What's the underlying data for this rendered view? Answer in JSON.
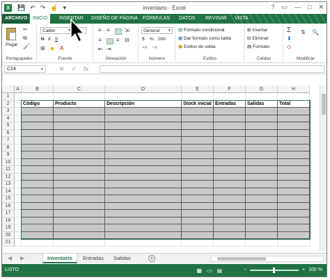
{
  "window": {
    "title": "inventario - Excel",
    "app_icon": "X",
    "qat": [
      "save-icon",
      "undo-icon",
      "redo-icon",
      "touch-mode-icon"
    ],
    "controls": [
      "?",
      "▭",
      "—",
      "□",
      "✕"
    ]
  },
  "tabs": {
    "file": "ARCHIVO",
    "items": [
      "INICIO",
      "INSERTAR",
      "DISEÑO DE PÁGINA",
      "FÓRMULAS",
      "DATOS",
      "REVISAR",
      "VISTA"
    ],
    "active": "INICIO"
  },
  "ribbon": {
    "clipboard": {
      "label": "Portapapeles",
      "paste": "Pegar"
    },
    "font": {
      "label": "Fuente",
      "font_name": "Calibri",
      "font_size": "11",
      "buttons": [
        "N",
        "K",
        "S"
      ]
    },
    "alignment": {
      "label": "Alineación"
    },
    "number": {
      "label": "Número",
      "format": "General",
      "buttons": [
        "$",
        "%",
        "000"
      ]
    },
    "styles": {
      "label": "Estilos",
      "conditional": "Formato condicional",
      "as_table": "Dar formato como tabla",
      "cell_styles": "Estilos de celda"
    },
    "cells": {
      "label": "Celdas",
      "insert": "Insertar",
      "delete": "Eliminar",
      "format": "Formato"
    },
    "editing": {
      "label": "Modificar"
    }
  },
  "formula_bar": {
    "name_box": "C24",
    "fx": "fx",
    "value": ""
  },
  "sheet": {
    "columns": [
      "A",
      "B",
      "C",
      "D",
      "E",
      "F",
      "G",
      "H"
    ],
    "rows": [
      "1",
      "2",
      "3",
      "4",
      "5",
      "6",
      "7",
      "8",
      "9",
      "10",
      "11",
      "12",
      "13",
      "14",
      "15",
      "16",
      "17",
      "18",
      "19",
      "20",
      "21"
    ],
    "headers": [
      "Código",
      "Producto",
      "Descripción",
      "Stock inicial",
      "Entradas",
      "Salidas",
      "Total"
    ]
  },
  "sheet_tabs": {
    "items": [
      "Inventario",
      "Entradas",
      "Salidas"
    ],
    "active": "Inventario"
  },
  "status": {
    "ready": "LISTO",
    "zoom": "100 %"
  },
  "colors": {
    "excel_green": "#217346",
    "table_fill": "#c8c8c8"
  }
}
